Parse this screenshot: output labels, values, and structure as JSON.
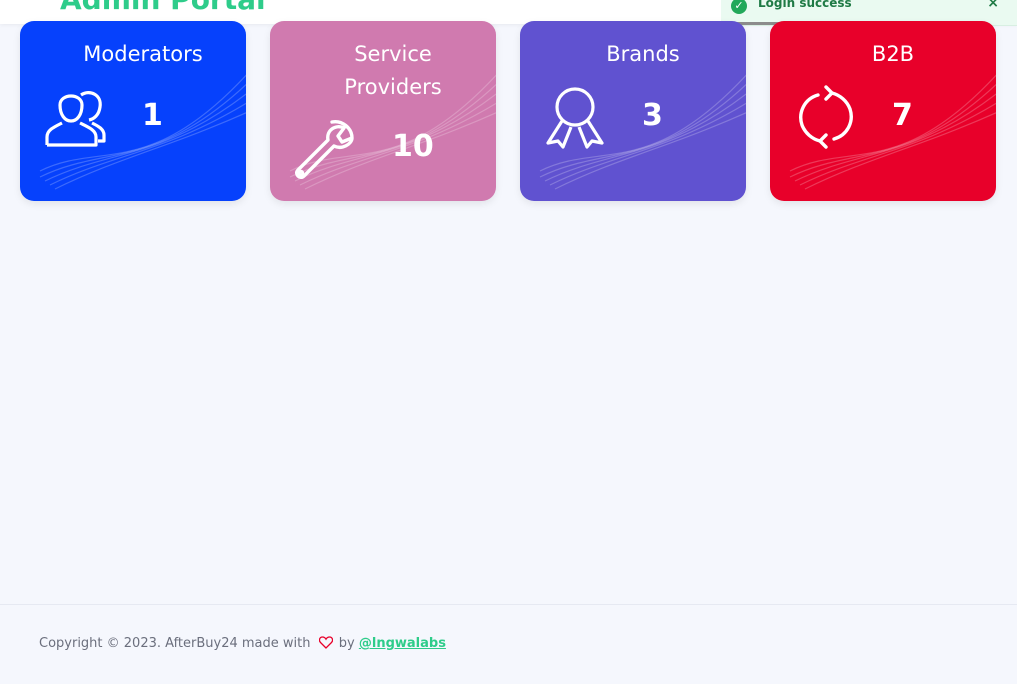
{
  "header": {
    "title": "Admin Portal",
    "menu_icon": "hamburger-icon"
  },
  "toast": {
    "message": "Login success",
    "status_color": "#22a85a",
    "close_label": "×",
    "icon": "check-circle-icon"
  },
  "cards": [
    {
      "title": "Moderators",
      "count": "1",
      "icon": "users-icon",
      "color": "#0641fc"
    },
    {
      "title": "Service Providers",
      "count": "10",
      "icon": "wrench-icon",
      "color": "#d07aaf"
    },
    {
      "title": "Brands",
      "count": "3",
      "icon": "award-icon",
      "color": "#6052d0"
    },
    {
      "title": "B2B",
      "count": "7",
      "icon": "refresh-icon",
      "color": "#e8002a"
    }
  ],
  "footer": {
    "copyright": "Copyright © 2023. AfterBuy24 made with",
    "by": "by",
    "link_text": "@lngwalabs",
    "heart_icon": "heart-icon"
  }
}
